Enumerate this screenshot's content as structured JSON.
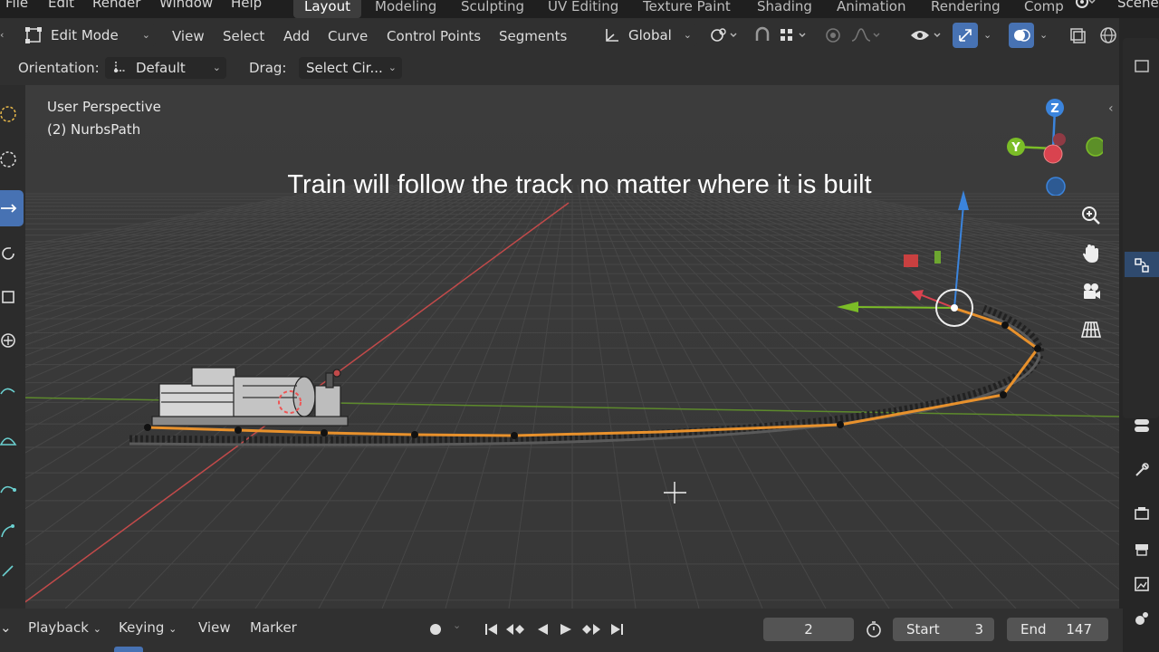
{
  "top_menu": {
    "items": [
      "File",
      "Edit",
      "Render",
      "Window",
      "Help"
    ],
    "workspaces": [
      "Layout",
      "Modeling",
      "Sculpting",
      "UV Editing",
      "Texture Paint",
      "Shading",
      "Animation",
      "Rendering",
      "Comp"
    ],
    "active_workspace": "Layout",
    "scene_label": "Scene"
  },
  "header": {
    "mode": "Edit Mode",
    "menus": [
      "View",
      "Select",
      "Add",
      "Curve",
      "Control Points",
      "Segments"
    ],
    "transform_orientation": "Global"
  },
  "tool_settings": {
    "orientation_label": "Orientation:",
    "orientation_value": "Default",
    "drag_label": "Drag:",
    "drag_value": "Select Cir..."
  },
  "viewport": {
    "view_name": "User Perspective",
    "object_name": "(2) NurbsPath",
    "caption": "Train will follow the track no matter where it is built",
    "gizmo": {
      "z": "Z",
      "y": "Y",
      "x_color": "#d9434f",
      "y_color": "#7bbd27",
      "z_color": "#3b84dc"
    }
  },
  "timeline": {
    "menus": [
      "Playback",
      "Keying",
      "View",
      "Marker"
    ],
    "current_frame": "2",
    "start_label": "Start",
    "start_value": "3",
    "end_label": "End",
    "end_value": "147"
  },
  "colors": {
    "accent": "#4772b3",
    "curve": "#e8912c",
    "x_axis": "#c24a4a",
    "y_axis": "#5d8a2c"
  }
}
